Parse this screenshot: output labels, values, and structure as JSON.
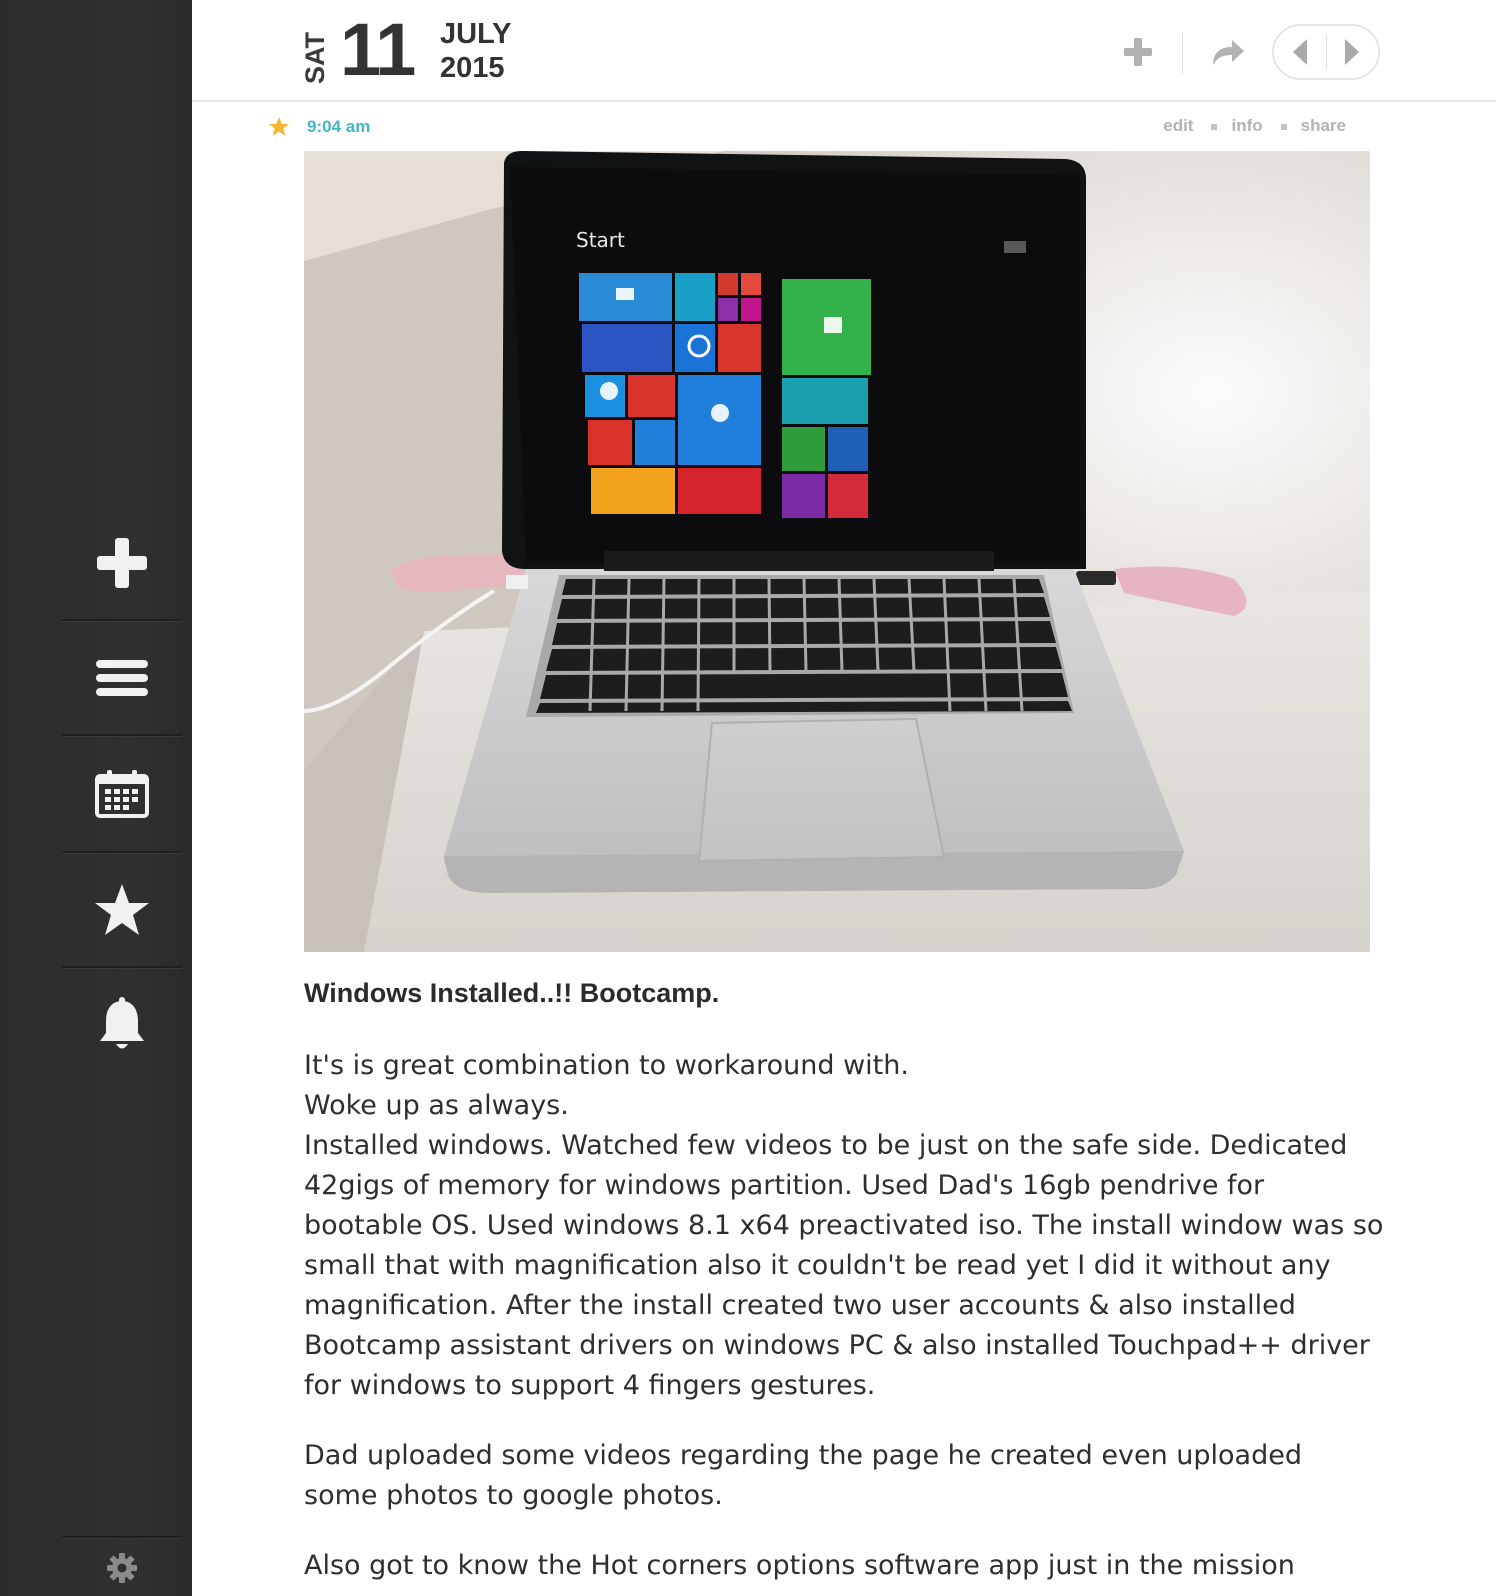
{
  "sidebar": {
    "items": [
      {
        "name": "new-entry",
        "icon": "plus-icon"
      },
      {
        "name": "list",
        "icon": "list-icon"
      },
      {
        "name": "calendar",
        "icon": "calendar-icon"
      },
      {
        "name": "starred",
        "icon": "star-icon"
      },
      {
        "name": "reminders",
        "icon": "bell-icon"
      }
    ],
    "settings_icon": "gear-icon"
  },
  "header": {
    "weekday": "SAT",
    "day": "11",
    "month": "JULY",
    "year": "2015",
    "icons": [
      "plus-icon",
      "share-arrow-icon",
      "chevron-left-icon",
      "chevron-right-icon"
    ]
  },
  "entry": {
    "starred": true,
    "time": "9:04 am",
    "actions": {
      "edit": "edit",
      "info": "info",
      "share": "share"
    },
    "title": "Windows Installed..!! Bootcamp.",
    "paragraph1": {
      "line1": "It's is great combination to workaround with.",
      "line2": "Woke up as always.",
      "line3": "Installed windows. Watched few videos to be just on the safe side. Dedicated 42gigs of memory for windows partition. Used Dad's 16gb pendrive for bootable OS. Used windows 8.1 x64 preactivated iso. The install window was so small that with magnification also it couldn't be read yet I did it without any magnification. After the install created two user accounts & also installed Bootcamp assistant drivers on windows PC & also installed Touchpad++ driver for windows to support 4 fingers gestures."
    },
    "paragraph2": "Dad uploaded some videos regarding the page he created even uploaded some photos to google photos.",
    "paragraph3": "Also got to know the Hot corners options software app just in the mission"
  },
  "photo_screen": {
    "start_label": "Start"
  },
  "colors": {
    "sidebar_bg": "#2e2e2f",
    "time_accent": "#41b6c9",
    "star_accent": "#f5b731",
    "muted_action": "#b3b3b3"
  }
}
